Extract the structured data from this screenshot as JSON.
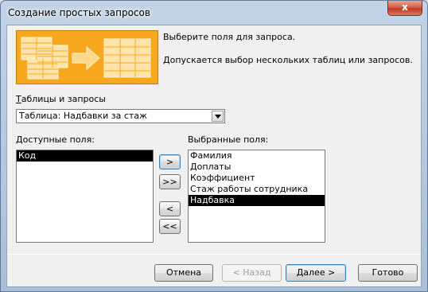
{
  "window": {
    "title": "Создание простых запросов",
    "close_glyph": "x"
  },
  "intro": {
    "line1": "Выберите поля для запроса.",
    "line2": "Допускается выбор нескольких таблиц или запросов."
  },
  "tables": {
    "label_accel": "Т",
    "label_rest": "аблицы и запросы",
    "selected": "Таблица: Надбавки за стаж"
  },
  "available": {
    "label_accel": "Д",
    "label_rest": "оступные поля:",
    "items": [
      "Код"
    ],
    "selected_index": 0
  },
  "chosen": {
    "label": "Выбранные поля:",
    "items": [
      "Фамилия",
      "Доплаты",
      "Коэффициент",
      "Стаж работы сотрудника",
      "Надбавка"
    ],
    "selected_index": 4
  },
  "move_buttons": {
    "add_one": ">",
    "add_all": ">>",
    "remove_one": "<",
    "remove_all": "<<"
  },
  "footer": {
    "cancel": "Отмена",
    "back": "< Назад",
    "next": "Далее >",
    "finish": "Готово"
  },
  "colors": {
    "illustration": "#f7a81f",
    "selection": "#000000"
  }
}
